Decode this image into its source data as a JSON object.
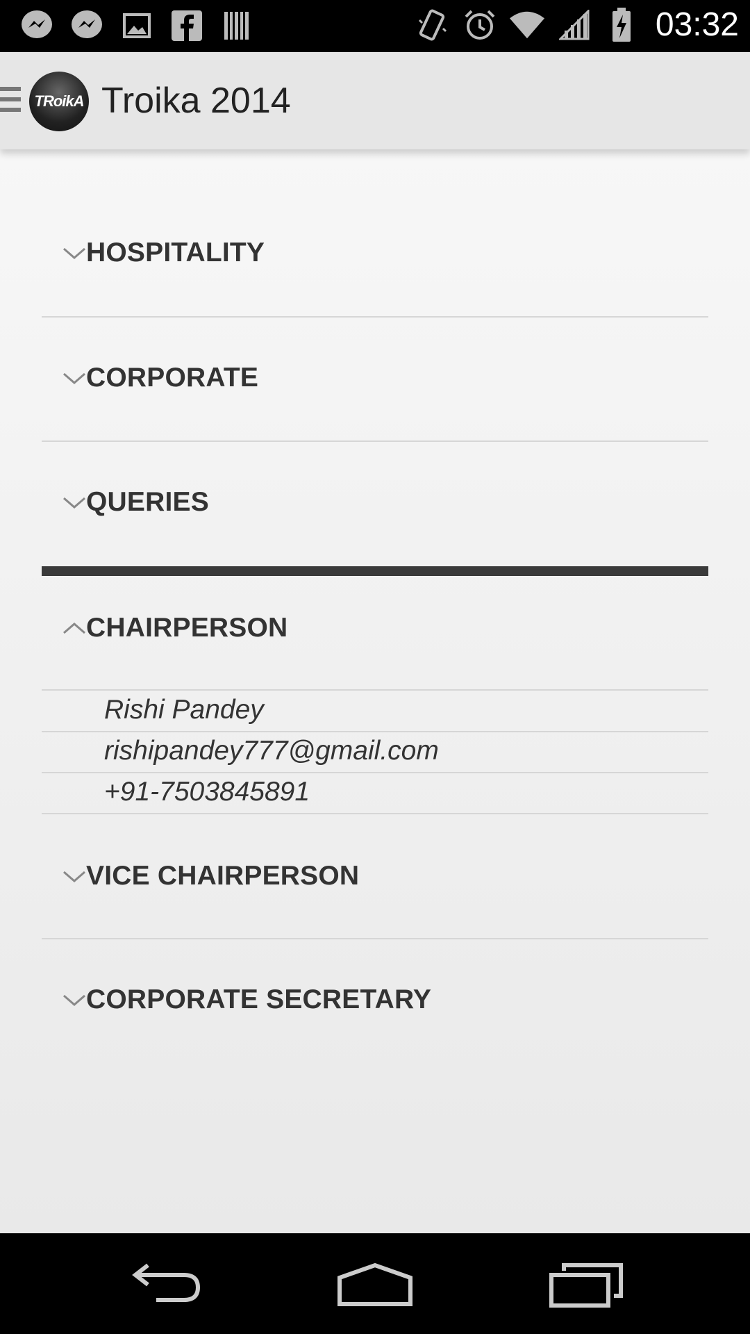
{
  "status_bar": {
    "time": "03:32",
    "left_icons": [
      "messenger-icon",
      "messenger-icon",
      "image-icon",
      "facebook-icon",
      "barcode-icon"
    ],
    "right_icons": [
      "vibrate-icon",
      "alarm-icon",
      "wifi-icon",
      "signal-icon",
      "battery-charging-icon"
    ]
  },
  "action_bar": {
    "title": "Troika 2014",
    "logo_text": "TRoikA"
  },
  "groups": [
    {
      "label": "HOSPITALITY",
      "expanded": false
    },
    {
      "label": "CORPORATE",
      "expanded": false
    },
    {
      "label": "QUERIES",
      "expanded": false
    },
    {
      "label": "CHAIRPERSON",
      "expanded": true,
      "children": [
        "Rishi Pandey",
        "rishipandey777@gmail.com",
        "+91-7503845891"
      ]
    },
    {
      "label": "VICE CHAIRPERSON",
      "expanded": false
    },
    {
      "label": "CORPORATE SECRETARY",
      "expanded": false
    }
  ],
  "nav_bar": {
    "buttons": [
      "back-icon",
      "home-icon",
      "recent-apps-icon"
    ]
  }
}
